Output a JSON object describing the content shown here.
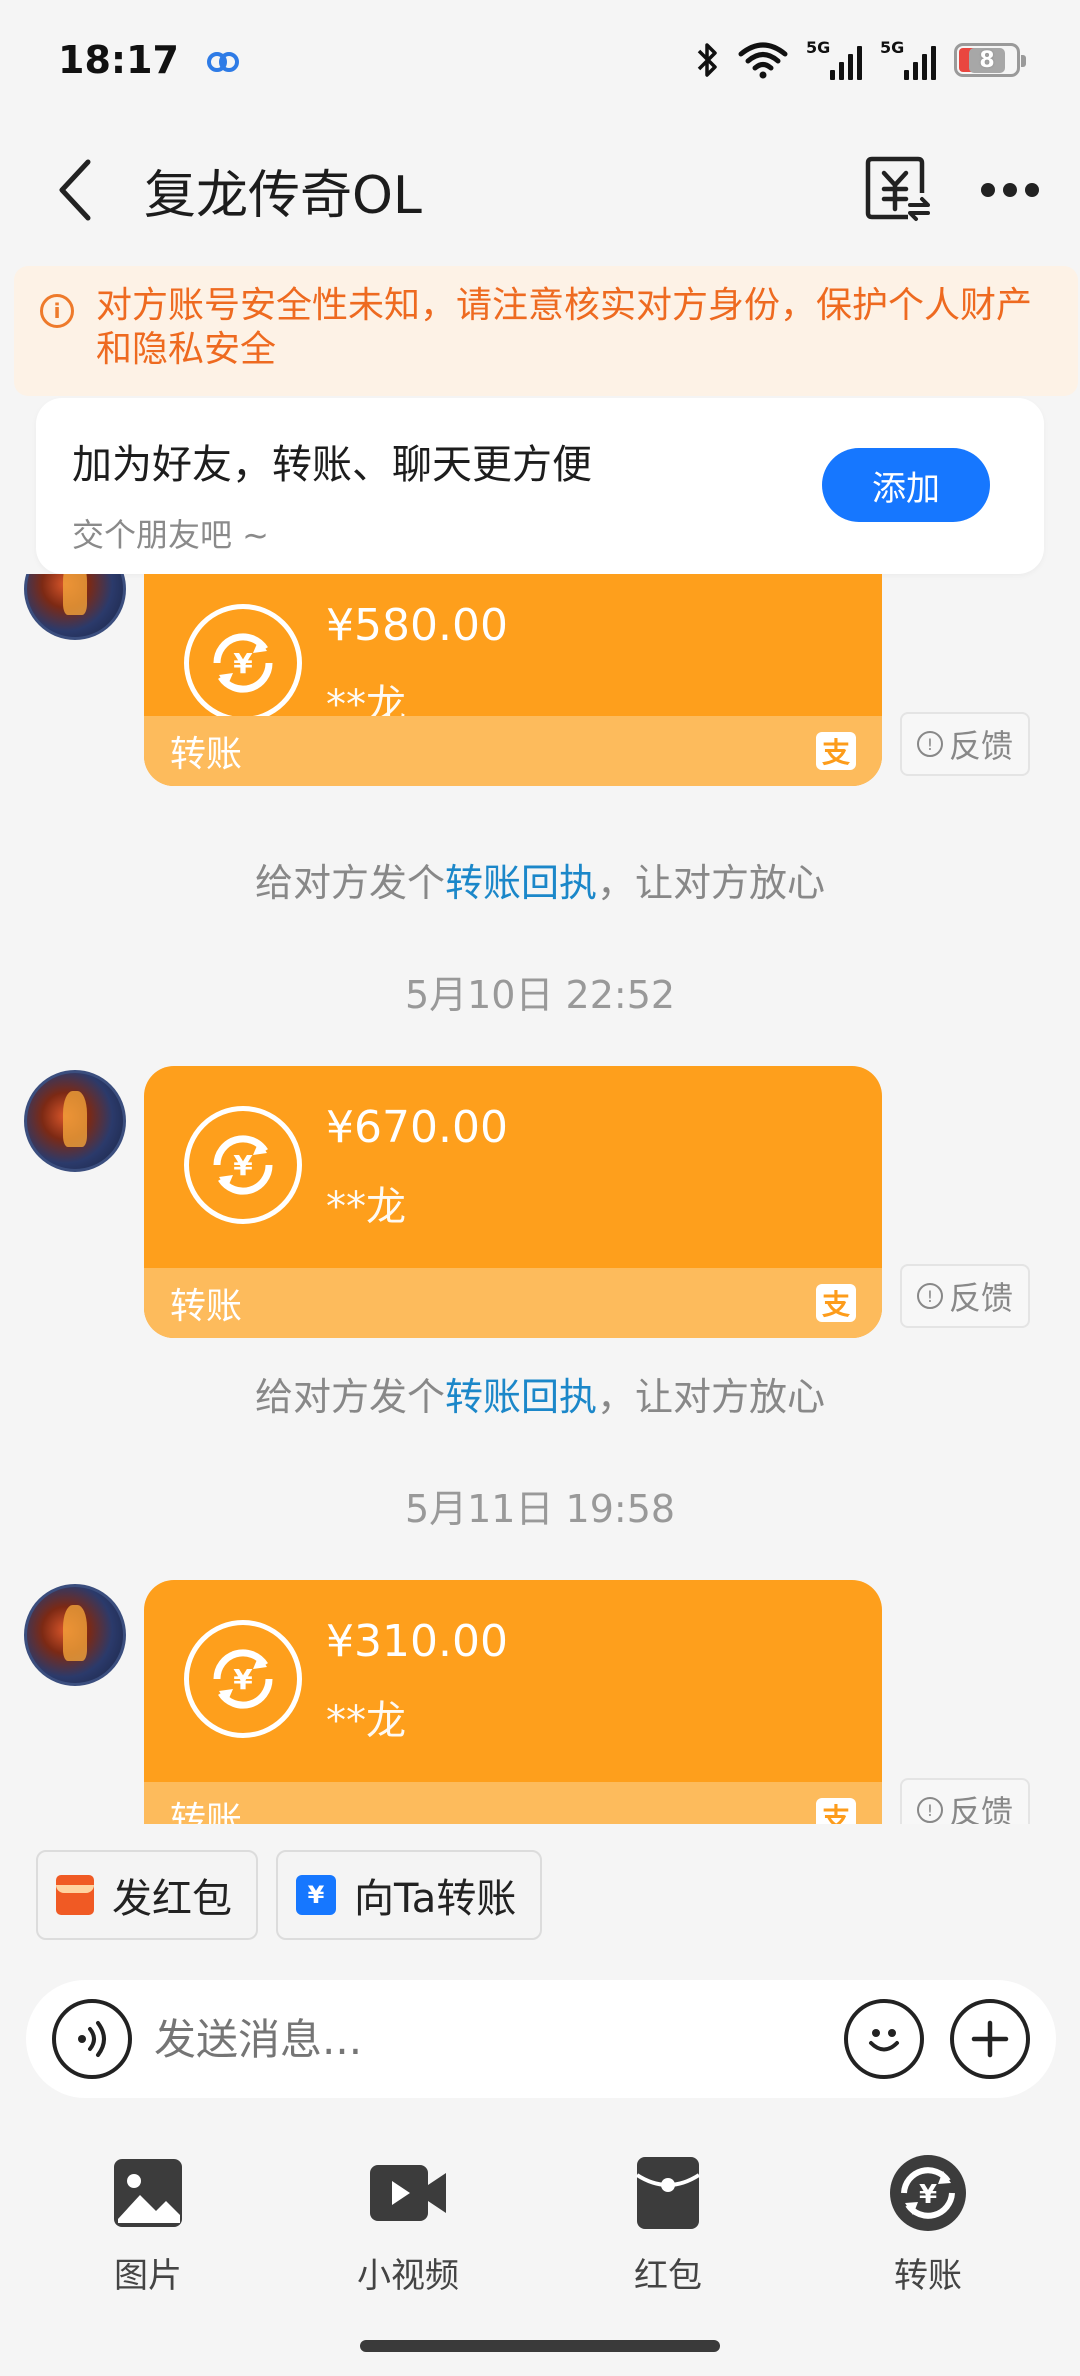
{
  "status_bar": {
    "time": "18:17",
    "network_5g_1": "5G",
    "network_5g_2": "5G",
    "battery": "8"
  },
  "header": {
    "title": "复龙传奇OL"
  },
  "warning": {
    "text": "对方账号安全性未知，请注意核实对方身份，保护个人财产和隐私安全"
  },
  "friend_card": {
    "title": "加为好友，转账、聊天更方便",
    "subtitle": "交个朋友吧 ~",
    "button": "添加"
  },
  "messages": [
    {
      "amount": "¥580.00",
      "name": "**龙",
      "label": "转账",
      "feedback": "反馈",
      "alipay": "支"
    },
    {
      "amount": "¥670.00",
      "name": "**龙",
      "label": "转账",
      "feedback": "反馈",
      "alipay": "支"
    },
    {
      "amount": "¥310.00",
      "name": "**龙",
      "label": "转账",
      "feedback": "反馈",
      "alipay": "支"
    }
  ],
  "hint": {
    "before": "给对方发个",
    "link": "转账回执",
    "after": "，让对方放心"
  },
  "timestamps": [
    "5月10日 22:52",
    "5月11日 19:58"
  ],
  "quick_actions": {
    "red_packet": "发红包",
    "transfer": "向Ta转账"
  },
  "input": {
    "placeholder": "发送消息..."
  },
  "toolbar": {
    "image": "图片",
    "video": "小视频",
    "red_packet": "红包",
    "transfer": "转账"
  },
  "icons": {
    "status": [
      "cloud-icon",
      "bluetooth-icon",
      "wifi-icon",
      "signal-5g-icon",
      "battery-icon"
    ],
    "header": [
      "back-icon",
      "transfer-bill-icon",
      "more-icon"
    ]
  },
  "colors": {
    "accent_blue": "#1677ff",
    "transfer_orange": "#fe9f1c",
    "warning_orange": "#ee6a20",
    "link_blue": "#1b87c9"
  }
}
